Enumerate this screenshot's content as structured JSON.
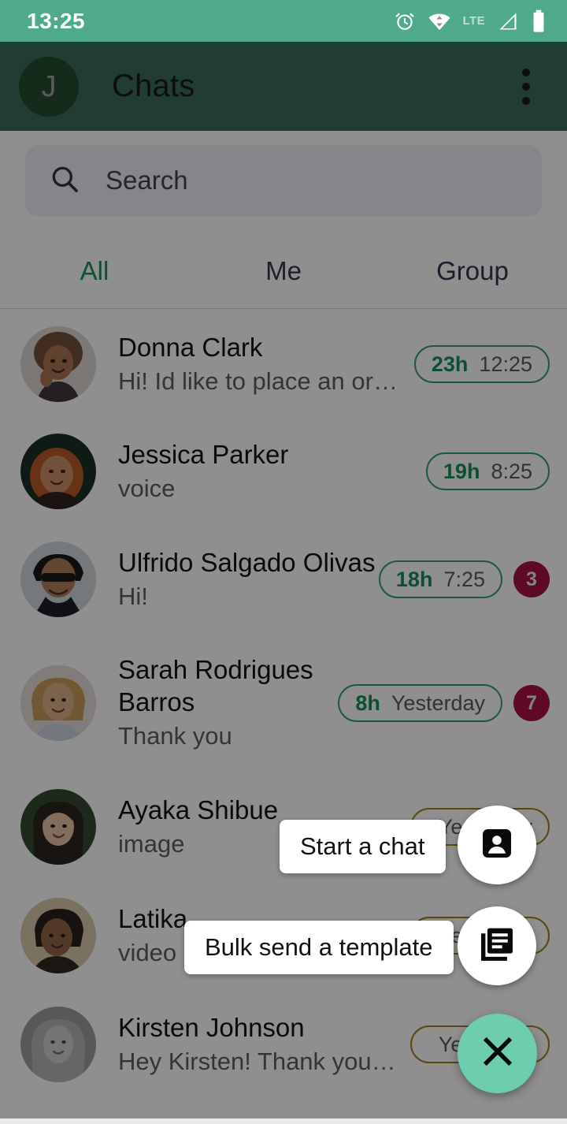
{
  "status_bar": {
    "time": "13:25",
    "lte_label": "LTE",
    "icons": [
      "alarm-icon",
      "wifi-icon",
      "lte-label",
      "signal-icon",
      "battery-icon"
    ]
  },
  "app_bar": {
    "avatar_initial": "J",
    "title": "Chats",
    "overflow_label": "More options"
  },
  "search": {
    "placeholder": "Search"
  },
  "tabs": [
    {
      "label": "All",
      "active": true
    },
    {
      "label": "Me",
      "active": false
    },
    {
      "label": "Group",
      "active": false
    }
  ],
  "chats": [
    {
      "name": "Donna Clark",
      "preview": "Hi! Id like to place an order. Can yo...",
      "hours": "23h",
      "time": "12:25",
      "pill_color": "green",
      "unread": null
    },
    {
      "name": "Jessica Parker",
      "preview": "voice",
      "hours": "19h",
      "time": "8:25",
      "pill_color": "green",
      "unread": null
    },
    {
      "name": "Ulfrido Salgado Olivas",
      "preview": "Hi!",
      "hours": "18h",
      "time": "7:25",
      "pill_color": "green",
      "unread": "3"
    },
    {
      "name": "Sarah Rodrigues Barros",
      "preview": "Thank you",
      "hours": "8h",
      "time": "Yesterday",
      "pill_color": "green",
      "unread": "7"
    },
    {
      "name": "Ayaka Shibue",
      "preview": "image",
      "hours": "",
      "time": "Yesterday",
      "pill_color": "amber",
      "unread": null
    },
    {
      "name": "Latika",
      "preview": "video",
      "hours": "",
      "time": "Yesterday",
      "pill_color": "amber",
      "unread": null
    },
    {
      "name": "Kirsten Johnson",
      "preview": "Hey Kirsten! Thank you for reaching...",
      "hours": "",
      "time": "Yesterday",
      "pill_color": "amber",
      "unread": null
    }
  ],
  "fab_menu": {
    "open": true,
    "actions": [
      {
        "label": "Start a chat",
        "icon": "contact-card-icon"
      },
      {
        "label": "Bulk send a template",
        "icon": "library-books-icon"
      }
    ],
    "main_icon": "close-icon",
    "main_color": "#6fcdaf"
  },
  "colors": {
    "status_bar": "#4faa8d",
    "app_bar": "#336653",
    "accent_green": "#17894f",
    "pill_green": "#2f9a6b",
    "pill_amber": "#9b7d14",
    "unread_badge": "#a5083c",
    "fab": "#6fcdaf",
    "scrim": "rgba(10,10,12,0.46)"
  }
}
